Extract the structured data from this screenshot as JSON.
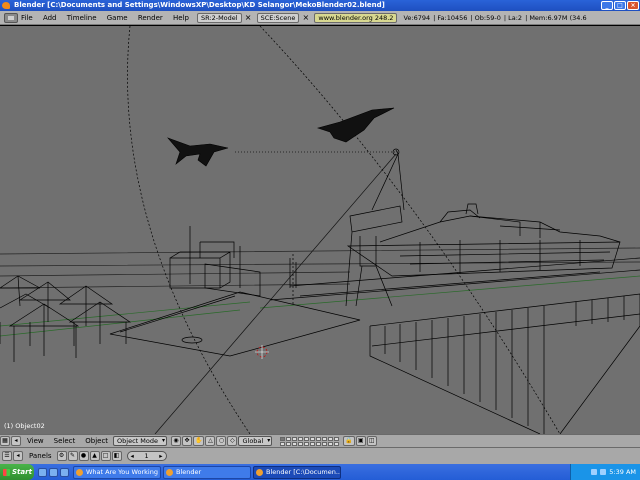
{
  "window": {
    "title": "Blender [C:\\Documents and Settings\\WindowsXP\\Desktop\\KD Selangor\\MekoBlender02.blend]",
    "buttons": [
      "_",
      "□",
      "×"
    ]
  },
  "header": {
    "menus": [
      "File",
      "Add",
      "Timeline",
      "Game",
      "Render",
      "Help"
    ],
    "screen": "SR:2-Model",
    "scene": "SCE:Scene",
    "url": "www.blender.org 248.2",
    "stats": {
      "verts": "Ve:6794",
      "faces": "Fa:10456",
      "objects": "Ob:59-0",
      "lamps": "La:2",
      "memory": "Mem:6.97M (34.6"
    }
  },
  "viewport": {
    "object_label": "(1) Object02",
    "background": "#707070"
  },
  "view_header": {
    "menus": [
      "View",
      "Select",
      "Object"
    ],
    "mode": "Object Mode",
    "orientation": "Global"
  },
  "buttons_header": {
    "panels_label": "Panels",
    "page": "1",
    "prev": "◂",
    "next": "▸"
  },
  "taskbar": {
    "start": "Start",
    "tasks": [
      "What Are You Working O...",
      "Blender",
      "Blender [C:\\Documen..."
    ],
    "clock": "5:39 AM"
  }
}
